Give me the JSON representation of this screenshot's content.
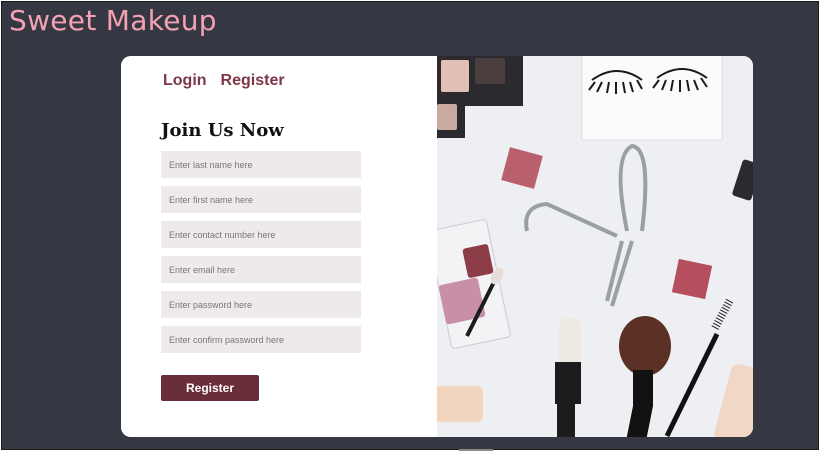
{
  "brand": {
    "title": "Sweet Makeup",
    "color": "#f3a1b3"
  },
  "nav": {
    "login": "Login",
    "register": "Register"
  },
  "form": {
    "heading": "Join Us Now",
    "fields": [
      {
        "placeholder": "Enter last name here",
        "value": ""
      },
      {
        "placeholder": "Enter first name here",
        "value": ""
      },
      {
        "placeholder": "Enter contact number here",
        "value": ""
      },
      {
        "placeholder": "Enter email here",
        "value": ""
      },
      {
        "placeholder": "Enter password here",
        "value": ""
      },
      {
        "placeholder": "Enter confirm password here",
        "value": ""
      }
    ],
    "submit_label": "Register"
  },
  "colors": {
    "background": "#353842",
    "accent": "#6a2e38",
    "nav_link": "#7b3846",
    "field_bg": "#efeaea"
  },
  "icons": [
    "eyeshadow-palette",
    "false-lashes",
    "eyelash-curler",
    "blush-square",
    "foundation-brush",
    "mascara-wand"
  ]
}
